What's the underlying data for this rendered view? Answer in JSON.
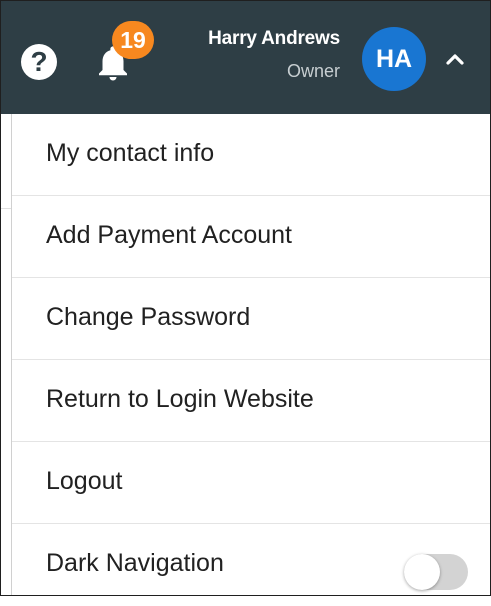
{
  "header": {
    "help_symbol": "?",
    "help_icon": "question-circle-icon",
    "bell_icon": "bell-icon",
    "notification_count": "19",
    "user_name": "Harry Andrews",
    "user_role": "Owner",
    "avatar_initials": "HA",
    "chevron_icon": "chevron-up-icon"
  },
  "menu": {
    "items": [
      {
        "label": "My contact info"
      },
      {
        "label": "Add Payment Account"
      },
      {
        "label": "Change Password"
      },
      {
        "label": "Return to Login Website"
      },
      {
        "label": "Logout"
      },
      {
        "label": "Dark Navigation"
      }
    ],
    "dark_navigation_enabled": false
  },
  "colors": {
    "header_bg": "#2e3e45",
    "badge": "#f7881f",
    "avatar": "#1976d2",
    "toggle_off": "#d3d3d3"
  }
}
